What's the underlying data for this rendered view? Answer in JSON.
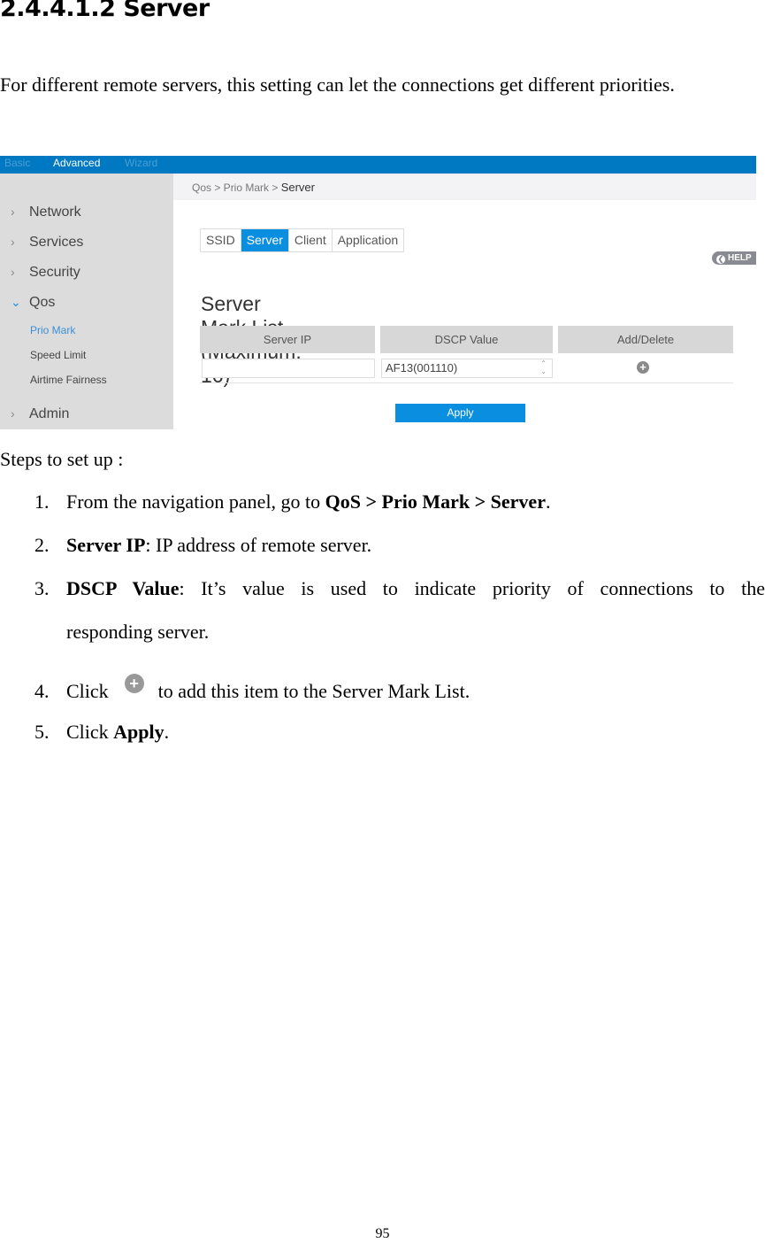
{
  "heading": "2.4.4.1.2 Server",
  "intro": "For different remote servers, this setting can let the connections get different priorities.",
  "screenshot": {
    "topbar": {
      "tabs": [
        "Basic",
        "Advanced",
        "Wizard"
      ],
      "active": "Advanced",
      "color": "#0079c2"
    },
    "sidebar": {
      "items": [
        "Network",
        "Services",
        "Security",
        "Qos",
        "Admin"
      ],
      "expanded": "Qos",
      "sub_items": [
        "Prio Mark",
        "Speed Limit",
        "Airtime Fairness"
      ],
      "active_sub": "Prio Mark"
    },
    "breadcrumb": {
      "path": "Qos > Prio Mark > ",
      "current": "Server"
    },
    "tabs": [
      "SSID",
      "Server",
      "Client",
      "Application"
    ],
    "active_tab": "Server",
    "help_label": "HELP",
    "list_title": "Server Mark List (Maximum: 16)",
    "columns": [
      "Server IP",
      "DSCP Value",
      "Add/Delete"
    ],
    "row": {
      "server_ip": "",
      "dscp_value": "AF13(001110)"
    },
    "apply_label": "Apply",
    "accent": "#0a8ee0"
  },
  "steps": {
    "intro": "Steps to set up :",
    "items": [
      {
        "num": "1.",
        "pre": "From the navigation panel, go to ",
        "bold": "QoS > Prio Mark > Server",
        "post": "."
      },
      {
        "num": "2.",
        "bold": "Server IP",
        "post": ": IP address of remote server."
      },
      {
        "num": "3.",
        "bold": "DSCP Value",
        "post": ": It’s value is used to indicate priority of connections to the",
        "cont": "responding server."
      },
      {
        "num": "4.",
        "pre": "Click",
        "icon": "add-circle-icon",
        "post": "to add this item to the Server Mark List."
      },
      {
        "num": "5.",
        "pre": "Click ",
        "bold": "Apply",
        "post": "."
      }
    ]
  },
  "page_number": "95"
}
